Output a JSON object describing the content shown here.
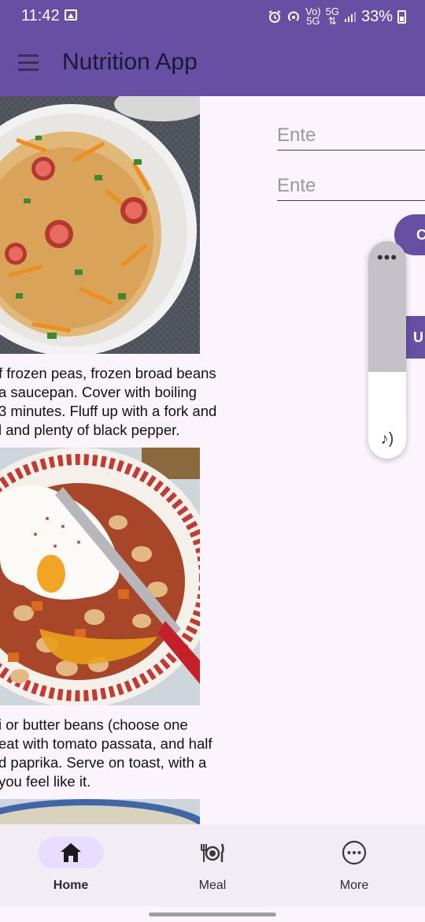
{
  "status_bar": {
    "time": "11:42",
    "net_label_top": "Vo)",
    "net_label_bottom": "5G",
    "net2_top": "5G",
    "battery": "33%"
  },
  "app_bar": {
    "title": "Nutrition App",
    "menu_icon": "hamburger-menu-icon"
  },
  "recipes": [
    {
      "description": "f frozen peas, frozen broad beans\n a saucepan. Cover with boiling\n3 minutes. Fluff up with a fork and\nl and plenty of black pepper."
    },
    {
      "description": "i or butter beans (choose one\neat with tomato passata, and half\nd paprika. Serve on toast, with a\n you feel like it."
    }
  ],
  "form": {
    "field1_placeholder": "Ente",
    "field2_placeholder": "Ente",
    "button1_label": "C",
    "button2_label": "U"
  },
  "volume_panel": {
    "level": 0.6,
    "more_icon": "more-dots-icon",
    "note_icon": "music-note-icon"
  },
  "bottom_nav": {
    "items": [
      {
        "label": "Home",
        "icon": "home-icon",
        "active": true
      },
      {
        "label": "Meal",
        "icon": "meal-icon",
        "active": false
      },
      {
        "label": "More",
        "icon": "more-circle-icon",
        "active": false
      }
    ]
  },
  "colors": {
    "primary": "#6750a4",
    "background": "#fcf4fc",
    "nav_active": "#e9ddff"
  }
}
